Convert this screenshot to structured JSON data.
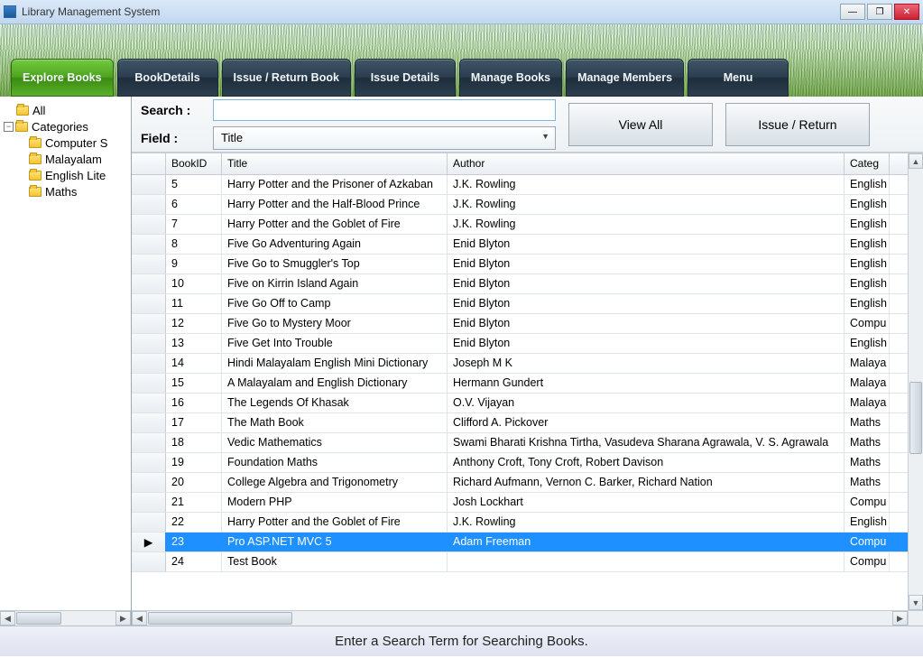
{
  "window": {
    "title": "Library Management System"
  },
  "tabs": [
    {
      "label": "Explore Books",
      "active": true
    },
    {
      "label": "BookDetails"
    },
    {
      "label": "Issue / Return Book"
    },
    {
      "label": "Issue Details"
    },
    {
      "label": "Manage Books"
    },
    {
      "label": "Manage Members"
    },
    {
      "label": "Menu"
    }
  ],
  "tree": {
    "all": "All",
    "categories": "Categories",
    "children": [
      "Computer S",
      "Malayalam",
      "English Lite",
      "Maths"
    ]
  },
  "search": {
    "search_label": "Search :",
    "field_label": "Field :",
    "field_value": "Title",
    "viewall": "View All",
    "issue_return": "Issue / Return"
  },
  "columns": [
    "",
    "BookID",
    "Title",
    "Author",
    "Categ"
  ],
  "rows": [
    {
      "id": "5",
      "title": "Harry Potter and the Prisoner of Azkaban",
      "author": "J.K. Rowling",
      "cat": "English"
    },
    {
      "id": "6",
      "title": "Harry Potter and the Half-Blood Prince",
      "author": "J.K. Rowling",
      "cat": "English"
    },
    {
      "id": "7",
      "title": "Harry Potter and the Goblet of Fire",
      "author": "J.K. Rowling",
      "cat": "English"
    },
    {
      "id": "8",
      "title": "Five Go Adventuring Again",
      "author": "Enid Blyton",
      "cat": "English"
    },
    {
      "id": "9",
      "title": "Five Go to Smuggler's Top",
      "author": "Enid Blyton",
      "cat": "English"
    },
    {
      "id": "10",
      "title": "Five on Kirrin Island Again",
      "author": "Enid Blyton",
      "cat": "English"
    },
    {
      "id": "11",
      "title": "Five Go Off to Camp",
      "author": "Enid Blyton",
      "cat": "English"
    },
    {
      "id": "12",
      "title": "Five Go to Mystery Moor",
      "author": "Enid Blyton",
      "cat": "Compu"
    },
    {
      "id": "13",
      "title": "Five Get Into Trouble",
      "author": "Enid Blyton",
      "cat": "English"
    },
    {
      "id": "14",
      "title": "Hindi Malayalam English Mini Dictionary",
      "author": "Joseph M K",
      "cat": "Malaya"
    },
    {
      "id": "15",
      "title": "A Malayalam and English Dictionary",
      "author": "Hermann Gundert",
      "cat": "Malaya"
    },
    {
      "id": "16",
      "title": "The Legends Of Khasak",
      "author": "O.V. Vijayan",
      "cat": "Malaya"
    },
    {
      "id": "17",
      "title": "The Math Book",
      "author": "Clifford A. Pickover",
      "cat": "Maths"
    },
    {
      "id": "18",
      "title": "Vedic Mathematics",
      "author": "Swami Bharati Krishna Tirtha, Vasudeva Sharana Agrawala, V. S. Agrawala",
      "cat": "Maths"
    },
    {
      "id": "19",
      "title": "Foundation Maths",
      "author": "Anthony Croft, Tony Croft, Robert Davison",
      "cat": "Maths"
    },
    {
      "id": "20",
      "title": "College Algebra and Trigonometry",
      "author": "Richard Aufmann, Vernon C. Barker, Richard Nation",
      "cat": "Maths"
    },
    {
      "id": "21",
      "title": "Modern PHP",
      "author": "Josh Lockhart",
      "cat": "Compu"
    },
    {
      "id": "22",
      "title": "Harry Potter and the Goblet of Fire",
      "author": "J.K. Rowling",
      "cat": "English"
    },
    {
      "id": "23",
      "title": "Pro ASP.NET MVC 5",
      "author": "Adam Freeman",
      "cat": "Compu",
      "selected": true
    },
    {
      "id": "24",
      "title": "Test Book",
      "author": "",
      "cat": "Compu"
    }
  ],
  "statusbar": "Enter a Search Term for Searching Books."
}
